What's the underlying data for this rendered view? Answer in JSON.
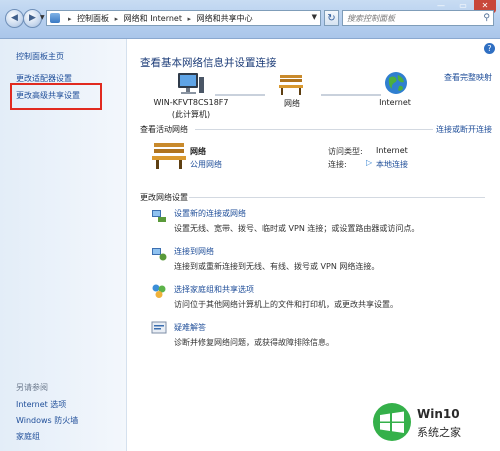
{
  "window": {
    "minimize_glyph": "—",
    "maximize_glyph": "▭",
    "close_glyph": "✕"
  },
  "address_bar": {
    "breadcrumbs": [
      "控制面板",
      "网络和 Internet",
      "网络和共享中心"
    ],
    "search_placeholder": "搜索控制面板"
  },
  "left_pane": {
    "home_link": "控制面板主页",
    "links": [
      "更改适配器设置",
      "更改高级共享设置"
    ],
    "see_also_heading": "另请参阅",
    "see_also_links": [
      "Internet 选项",
      "Windows 防火墙",
      "家庭组"
    ]
  },
  "main": {
    "title": "查看基本网络信息并设置连接",
    "view_full_map": "查看完整映射",
    "map_nodes": [
      {
        "label": "WIN-KFVT8CS18F7",
        "sublabel": "(此计算机)"
      },
      {
        "label": "网络"
      },
      {
        "label": "Internet"
      }
    ],
    "active_networks_heading": "查看活动网络",
    "connect_disconnect": "连接或断开连接",
    "active_network": {
      "name": "网络",
      "type": "公用网络",
      "access_type_label": "访问类型:",
      "access_type_value": "Internet",
      "connections_label": "连接:",
      "connections_value": "本地连接"
    },
    "change_settings_heading": "更改网络设置",
    "tasks": [
      {
        "icon": "network-setup-icon",
        "title": "设置新的连接或网络",
        "desc": "设置无线、宽带、拨号、临时或 VPN 连接；或设置路由器或访问点。"
      },
      {
        "icon": "connect-network-icon",
        "title": "连接到网络",
        "desc": "连接到或重新连接到无线、有线、拨号或 VPN 网络连接。"
      },
      {
        "icon": "homegroup-icon",
        "title": "选择家庭组和共享选项",
        "desc": "访问位于其他网络计算机上的文件和打印机，或更改共享设置。"
      },
      {
        "icon": "troubleshoot-icon",
        "title": "疑难解答",
        "desc": "诊断并修复网络问题，或获得故障排除信息。"
      }
    ]
  },
  "watermark": {
    "title": "Win10",
    "subtitle": "系统之家"
  },
  "colors": {
    "link": "#1f4e99",
    "title": "#1c3c78",
    "highlight_border": "#e12a1f",
    "address_bar": "#b6cfee"
  }
}
